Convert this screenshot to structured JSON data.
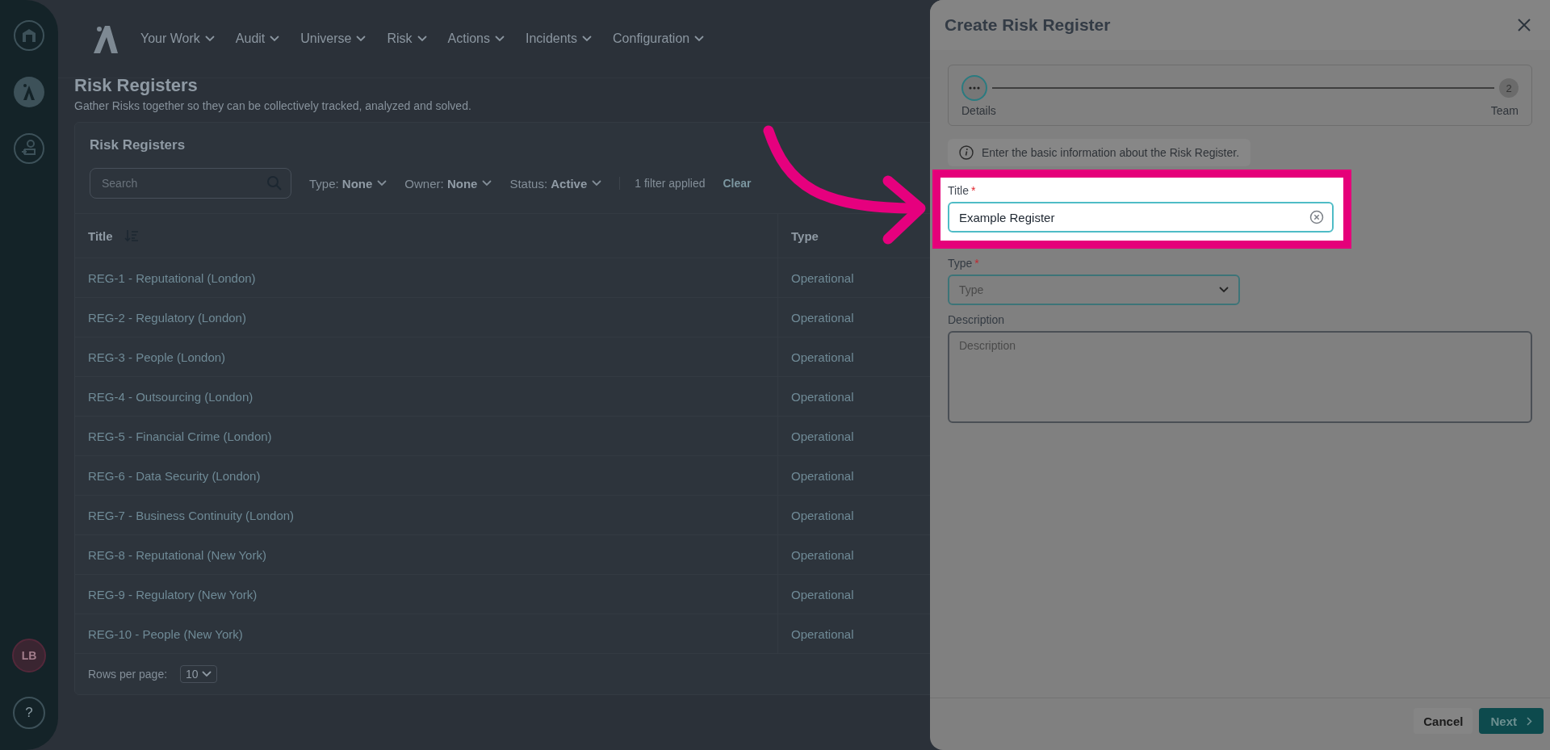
{
  "sidebar": {
    "avatar": "LB",
    "help": "?"
  },
  "nav": {
    "items": [
      "Your Work",
      "Audit",
      "Universe",
      "Risk",
      "Actions",
      "Incidents",
      "Configuration"
    ]
  },
  "page": {
    "title": "Risk Registers",
    "subtitle": "Gather Risks together so they can be collectively tracked, analyzed and solved."
  },
  "card": {
    "title": "Risk Registers",
    "search": {
      "placeholder": "Search"
    },
    "filters": [
      {
        "label": "Type:",
        "value": "None"
      },
      {
        "label": "Owner:",
        "value": "None"
      },
      {
        "label": "Status:",
        "value": "Active"
      }
    ],
    "filter_count": "1 filter applied",
    "clear": "Clear",
    "table": {
      "columns": [
        "Title",
        "Type"
      ],
      "rows": [
        [
          "REG-1 - Reputational (London)",
          "Operational"
        ],
        [
          "REG-2 - Regulatory (London)",
          "Operational"
        ],
        [
          "REG-3 - People (London)",
          "Operational"
        ],
        [
          "REG-4 - Outsourcing (London)",
          "Operational"
        ],
        [
          "REG-5 - Financial Crime (London)",
          "Operational"
        ],
        [
          "REG-6 - Data Security (London)",
          "Operational"
        ],
        [
          "REG-7 - Business Continuity (London)",
          "Operational"
        ],
        [
          "REG-8 - Reputational (New York)",
          "Operational"
        ],
        [
          "REG-9 - Regulatory (New York)",
          "Operational"
        ],
        [
          "REG-10 - People (New York)",
          "Operational"
        ]
      ]
    },
    "rows_per_page": {
      "label": "Rows per page:",
      "value": "10"
    }
  },
  "drawer": {
    "title": "Create Risk Register",
    "required_mark": "*",
    "steps": [
      {
        "label": "Details",
        "current": true
      },
      {
        "label": "Team",
        "number": "2",
        "current": false
      }
    ],
    "info": "Enter the basic information about the Risk Register.",
    "fields": [
      {
        "kind": "text",
        "label": "Title",
        "required": true,
        "value": "Example Register",
        "highlighted": true
      },
      {
        "kind": "select",
        "label": "Type",
        "required": true,
        "placeholder": "Type",
        "highlighted": false
      },
      {
        "kind": "textarea",
        "label": "Description",
        "required": false,
        "placeholder": "Description",
        "highlighted": false
      }
    ],
    "buttons": [
      {
        "label": "Cancel",
        "kind": "secondary"
      },
      {
        "label": "Next",
        "kind": "primary"
      }
    ]
  }
}
